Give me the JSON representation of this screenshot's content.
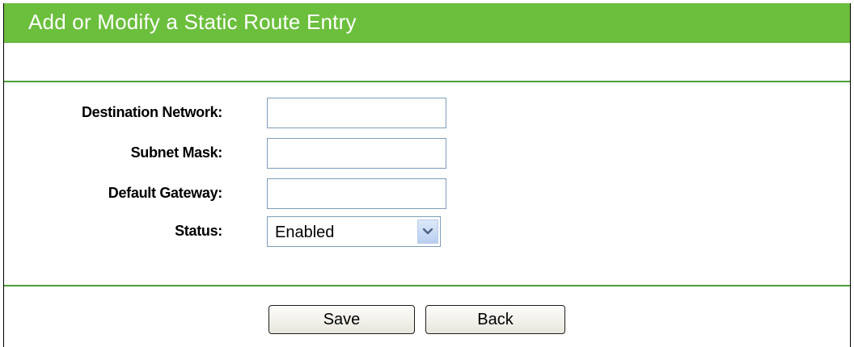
{
  "header": {
    "title": "Add or Modify a Static Route Entry"
  },
  "form": {
    "destination_network": {
      "label": "Destination Network:",
      "value": ""
    },
    "subnet_mask": {
      "label": "Subnet Mask:",
      "value": ""
    },
    "default_gateway": {
      "label": "Default Gateway:",
      "value": ""
    },
    "status": {
      "label": "Status:",
      "selected": "Enabled"
    }
  },
  "buttons": {
    "save_label": "Save",
    "back_label": "Back"
  },
  "colors": {
    "header_bg": "#6cbf3d",
    "divider": "#4f9e3a"
  },
  "icons": {
    "dropdown": "chevron-down-icon"
  }
}
